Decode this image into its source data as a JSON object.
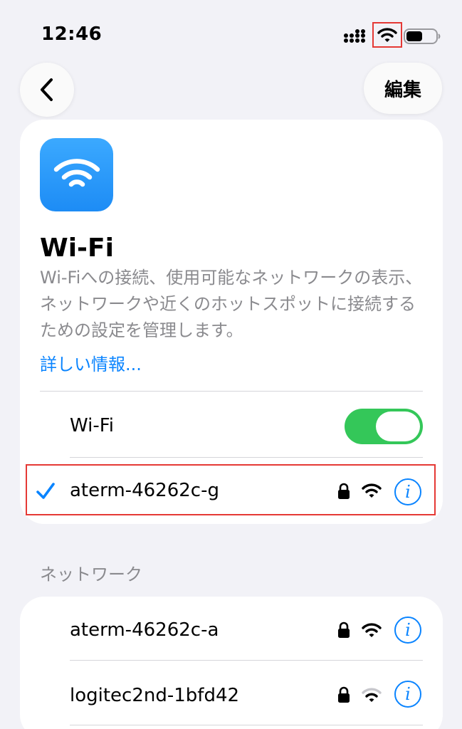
{
  "status_bar": {
    "time": "12:46"
  },
  "nav": {
    "edit_label": "編集"
  },
  "header": {
    "title": "Wi-Fi",
    "description": "Wi-Fiへの接続、使用可能なネットワークの表示、ネットワークや近くのホットスポットに接続するための設定を管理します。",
    "learn_more": "詳しい情報..."
  },
  "wifi_toggle": {
    "label": "Wi-Fi",
    "enabled": true
  },
  "connected_network": {
    "name": "aterm-46262c-g",
    "secured": true
  },
  "networks_section": {
    "title": "ネットワーク",
    "items": [
      {
        "name": "aterm-46262c-a",
        "secured": true,
        "signal": "full"
      },
      {
        "name": "logitec2nd-1bfd42",
        "secured": true,
        "signal": "medium"
      }
    ]
  },
  "colors": {
    "accent": "#0a84ff",
    "toggle_on": "#34c759",
    "highlight": "#e53935",
    "background": "#f2f2f7"
  }
}
